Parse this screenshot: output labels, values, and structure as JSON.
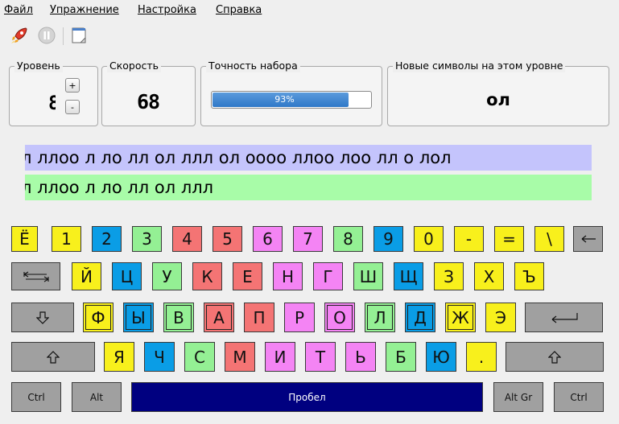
{
  "menu": [
    {
      "label": "Файл"
    },
    {
      "label": "Упражнение"
    },
    {
      "label": "Настройка"
    },
    {
      "label": "Справка"
    }
  ],
  "toolbar": {
    "buttons": [
      {
        "icon": "rocket-icon"
      },
      {
        "icon": "pause-icon"
      },
      {
        "icon": "notepad-icon"
      }
    ]
  },
  "level": {
    "title": "Уровень",
    "value": "8",
    "plus": "+",
    "minus": "-"
  },
  "speed": {
    "title": "Скорость",
    "value": "68"
  },
  "accuracy": {
    "title": "Точность набора",
    "percent": 93,
    "text": "93%"
  },
  "new_symbols": {
    "title": "Новые символы на этом уровне",
    "value": "ол"
  },
  "exercise": {
    "target_text": "л ллоо л ло лл ол ллл ол оооо ллоо лоо лл о лол",
    "typed_text": "л ллоо л ло лл ол ллл"
  },
  "colors": {
    "yellow": "#f8f01c",
    "blue": "#0a9de6",
    "green": "#94f094",
    "red": "#f47474",
    "pink": "#f484f4",
    "grey": "#a0a0a0",
    "space": "#000080",
    "target_line": "#c4c4fc",
    "typed_line": "#a8fca8"
  },
  "keyboard": {
    "rows": [
      [
        {
          "label": "Ё",
          "color": "yellow"
        },
        {
          "label": "1",
          "color": "yellow"
        },
        {
          "label": "2",
          "color": "blue"
        },
        {
          "label": "3",
          "color": "green"
        },
        {
          "label": "4",
          "color": "red"
        },
        {
          "label": "5",
          "color": "red"
        },
        {
          "label": "6",
          "color": "pink"
        },
        {
          "label": "7",
          "color": "pink"
        },
        {
          "label": "8",
          "color": "green"
        },
        {
          "label": "9",
          "color": "blue"
        },
        {
          "label": "0",
          "color": "yellow"
        },
        {
          "label": "-",
          "color": "yellow"
        },
        {
          "label": "=",
          "color": "yellow"
        },
        {
          "label": "\\",
          "color": "yellow"
        },
        {
          "label": "",
          "color": "grey",
          "icon": "backspace-icon"
        }
      ],
      [
        {
          "label": "",
          "color": "grey",
          "icon": "tab-icon"
        },
        {
          "label": "Й",
          "color": "yellow"
        },
        {
          "label": "Ц",
          "color": "blue"
        },
        {
          "label": "У",
          "color": "green"
        },
        {
          "label": "К",
          "color": "red"
        },
        {
          "label": "Е",
          "color": "red"
        },
        {
          "label": "Н",
          "color": "pink"
        },
        {
          "label": "Г",
          "color": "pink"
        },
        {
          "label": "Ш",
          "color": "green"
        },
        {
          "label": "Щ",
          "color": "blue"
        },
        {
          "label": "З",
          "color": "yellow"
        },
        {
          "label": "Х",
          "color": "yellow"
        },
        {
          "label": "Ъ",
          "color": "yellow"
        }
      ],
      [
        {
          "label": "",
          "color": "grey",
          "icon": "caps-lock-icon"
        },
        {
          "label": "Ф",
          "color": "yellow",
          "home": true
        },
        {
          "label": "Ы",
          "color": "blue",
          "home": true
        },
        {
          "label": "В",
          "color": "green",
          "home": true
        },
        {
          "label": "А",
          "color": "red",
          "home": true
        },
        {
          "label": "П",
          "color": "red"
        },
        {
          "label": "Р",
          "color": "pink"
        },
        {
          "label": "О",
          "color": "pink",
          "home": true
        },
        {
          "label": "Л",
          "color": "green",
          "home": true
        },
        {
          "label": "Д",
          "color": "blue",
          "home": true
        },
        {
          "label": "Ж",
          "color": "yellow",
          "home": true
        },
        {
          "label": "Э",
          "color": "yellow"
        },
        {
          "label": "",
          "color": "grey",
          "icon": "enter-icon"
        }
      ],
      [
        {
          "label": "",
          "color": "grey",
          "icon": "shift-icon"
        },
        {
          "label": "Я",
          "color": "yellow"
        },
        {
          "label": "Ч",
          "color": "blue"
        },
        {
          "label": "С",
          "color": "green"
        },
        {
          "label": "М",
          "color": "red"
        },
        {
          "label": "И",
          "color": "pink"
        },
        {
          "label": "Т",
          "color": "pink"
        },
        {
          "label": "Ь",
          "color": "pink"
        },
        {
          "label": "Б",
          "color": "green"
        },
        {
          "label": "Ю",
          "color": "blue"
        },
        {
          "label": ".",
          "color": "yellow"
        },
        {
          "label": "",
          "color": "grey",
          "icon": "shift-icon"
        }
      ],
      [
        {
          "label": "Ctrl",
          "color": "grey"
        },
        {
          "label": "Alt",
          "color": "grey"
        },
        {
          "label": "Пробел",
          "color": "space"
        },
        {
          "label": "Alt Gr",
          "color": "grey"
        },
        {
          "label": "Ctrl",
          "color": "grey"
        }
      ]
    ]
  }
}
